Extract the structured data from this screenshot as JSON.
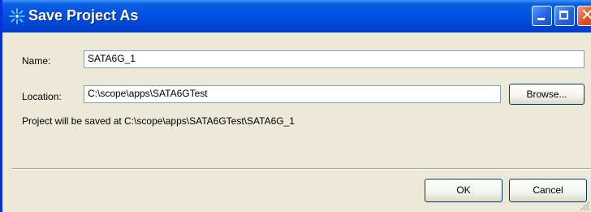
{
  "window": {
    "title": "Save Project As"
  },
  "form": {
    "name_label": "Name:",
    "name_value": "SATA6G_1",
    "location_label": "Location:",
    "location_value": "C:\\scope\\apps\\SATA6GTest",
    "browse_label": "Browse...",
    "save_path_text": "Project will be saved at C:\\scope\\apps\\SATA6GTest\\SATA6G_1"
  },
  "buttons": {
    "ok": "OK",
    "cancel": "Cancel"
  },
  "icons": {
    "app": "sparkle-icon",
    "minimize": "minimize-icon",
    "maximize": "maximize-icon",
    "close": "close-icon"
  },
  "colors": {
    "titlebar": "#0053e6",
    "window_bg": "#ece9d8",
    "close_button": "#e0502a"
  }
}
